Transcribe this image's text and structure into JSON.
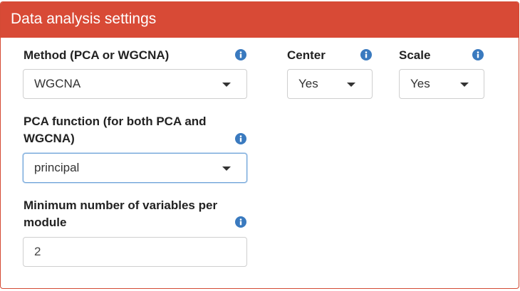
{
  "panel": {
    "title": "Data analysis settings"
  },
  "method": {
    "label": "Method (PCA or WGCNA)",
    "value": "WGCNA",
    "icon": "info-icon"
  },
  "center": {
    "label": "Center",
    "value": "Yes",
    "icon": "info-icon"
  },
  "scale": {
    "label": "Scale",
    "value": "Yes",
    "icon": "info-icon"
  },
  "pca_function": {
    "label_line1": "PCA function (for both PCA and",
    "label_line2": "WGCNA)",
    "value": "principal",
    "icon": "info-icon"
  },
  "min_vars": {
    "label_line1": "Minimum number of variables per",
    "label_line2": "module",
    "value": "2",
    "icon": "info-icon"
  },
  "colors": {
    "header": "#d84a36",
    "info": "#3a7abf",
    "focus_border": "#6fa3d8"
  }
}
